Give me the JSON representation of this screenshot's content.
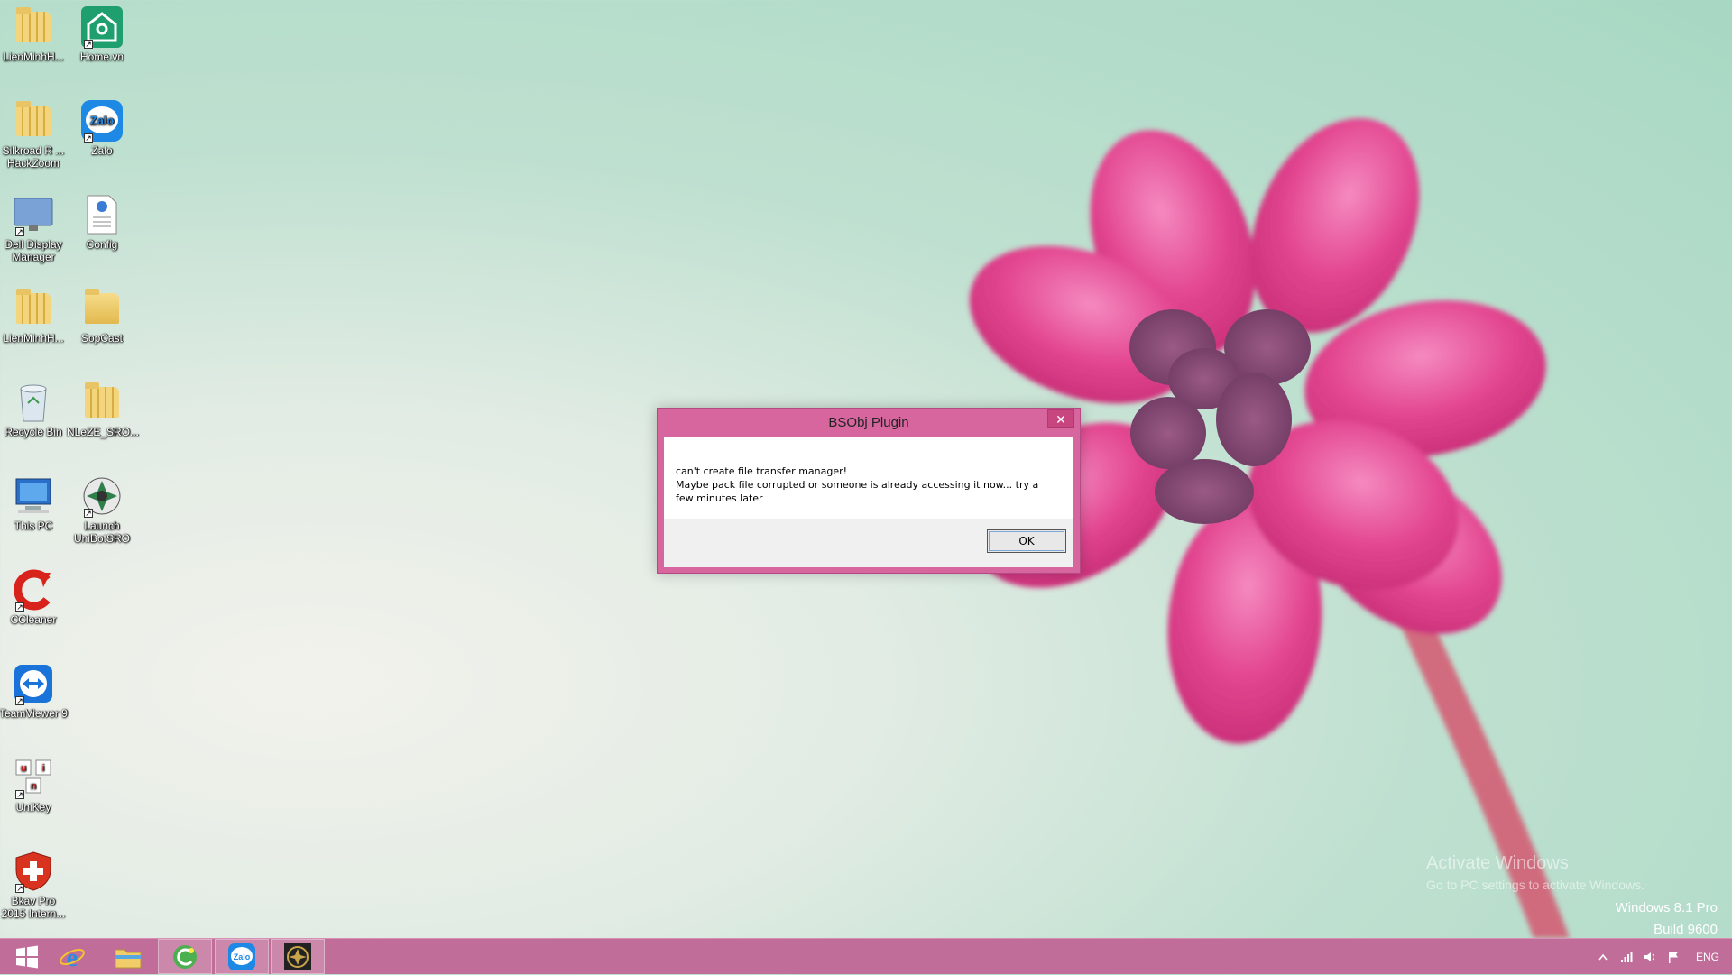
{
  "desktop": {
    "icons": [
      {
        "label": "LienMinhH...",
        "icon": "folder-icon"
      },
      {
        "label": "Home.vn",
        "icon": "home-app-icon"
      },
      {
        "label": "Silkroad R ... HackZoom",
        "icon": "folder-icon"
      },
      {
        "label": "Zalo",
        "icon": "zalo-icon"
      },
      {
        "label": "Dell Display Manager",
        "icon": "monitor-icon"
      },
      {
        "label": "Config",
        "icon": "config-file-icon"
      },
      {
        "label": "LienMinhH...",
        "icon": "folder-icon"
      },
      {
        "label": "SopCast",
        "icon": "folder-icon"
      },
      {
        "label": "Recycle Bin",
        "icon": "recycle-bin-icon"
      },
      {
        "label": "NLeZE_SRO...",
        "icon": "folder-icon"
      },
      {
        "label": "This PC",
        "icon": "computer-icon"
      },
      {
        "label": "Launch UniBotSRO",
        "icon": "unibot-icon"
      },
      {
        "label": "CCleaner",
        "icon": "ccleaner-icon"
      },
      {
        "label": "TeamViewer 9",
        "icon": "teamviewer-icon"
      },
      {
        "label": "UniKey",
        "icon": "unikey-icon"
      },
      {
        "label": "Bkav Pro 2015 Intern...",
        "icon": "bkav-icon"
      }
    ]
  },
  "dialog": {
    "title": "BSObj Plugin",
    "close_symbol": "✕",
    "message_line1": "can't create file transfer manager!",
    "message_line2": "Maybe pack file corrupted or someone is already accessing it now... try a few minutes later",
    "ok_label": "OK"
  },
  "watermark": {
    "activate_title": "Activate Windows",
    "activate_sub": "Go to PC settings to activate Windows.",
    "edition": "Windows 8.1 Pro",
    "build": "Build 9600"
  },
  "taskbar": {
    "apps": [
      "start-icon",
      "internet-explorer-icon",
      "file-explorer-icon",
      "coc-coc-icon",
      "zalo-icon",
      "unibot-icon"
    ],
    "language": "ENG"
  },
  "colors": {
    "dialog_frame": "#d7669f",
    "taskbar": "#c06e99",
    "close_button": "#c8467f"
  }
}
